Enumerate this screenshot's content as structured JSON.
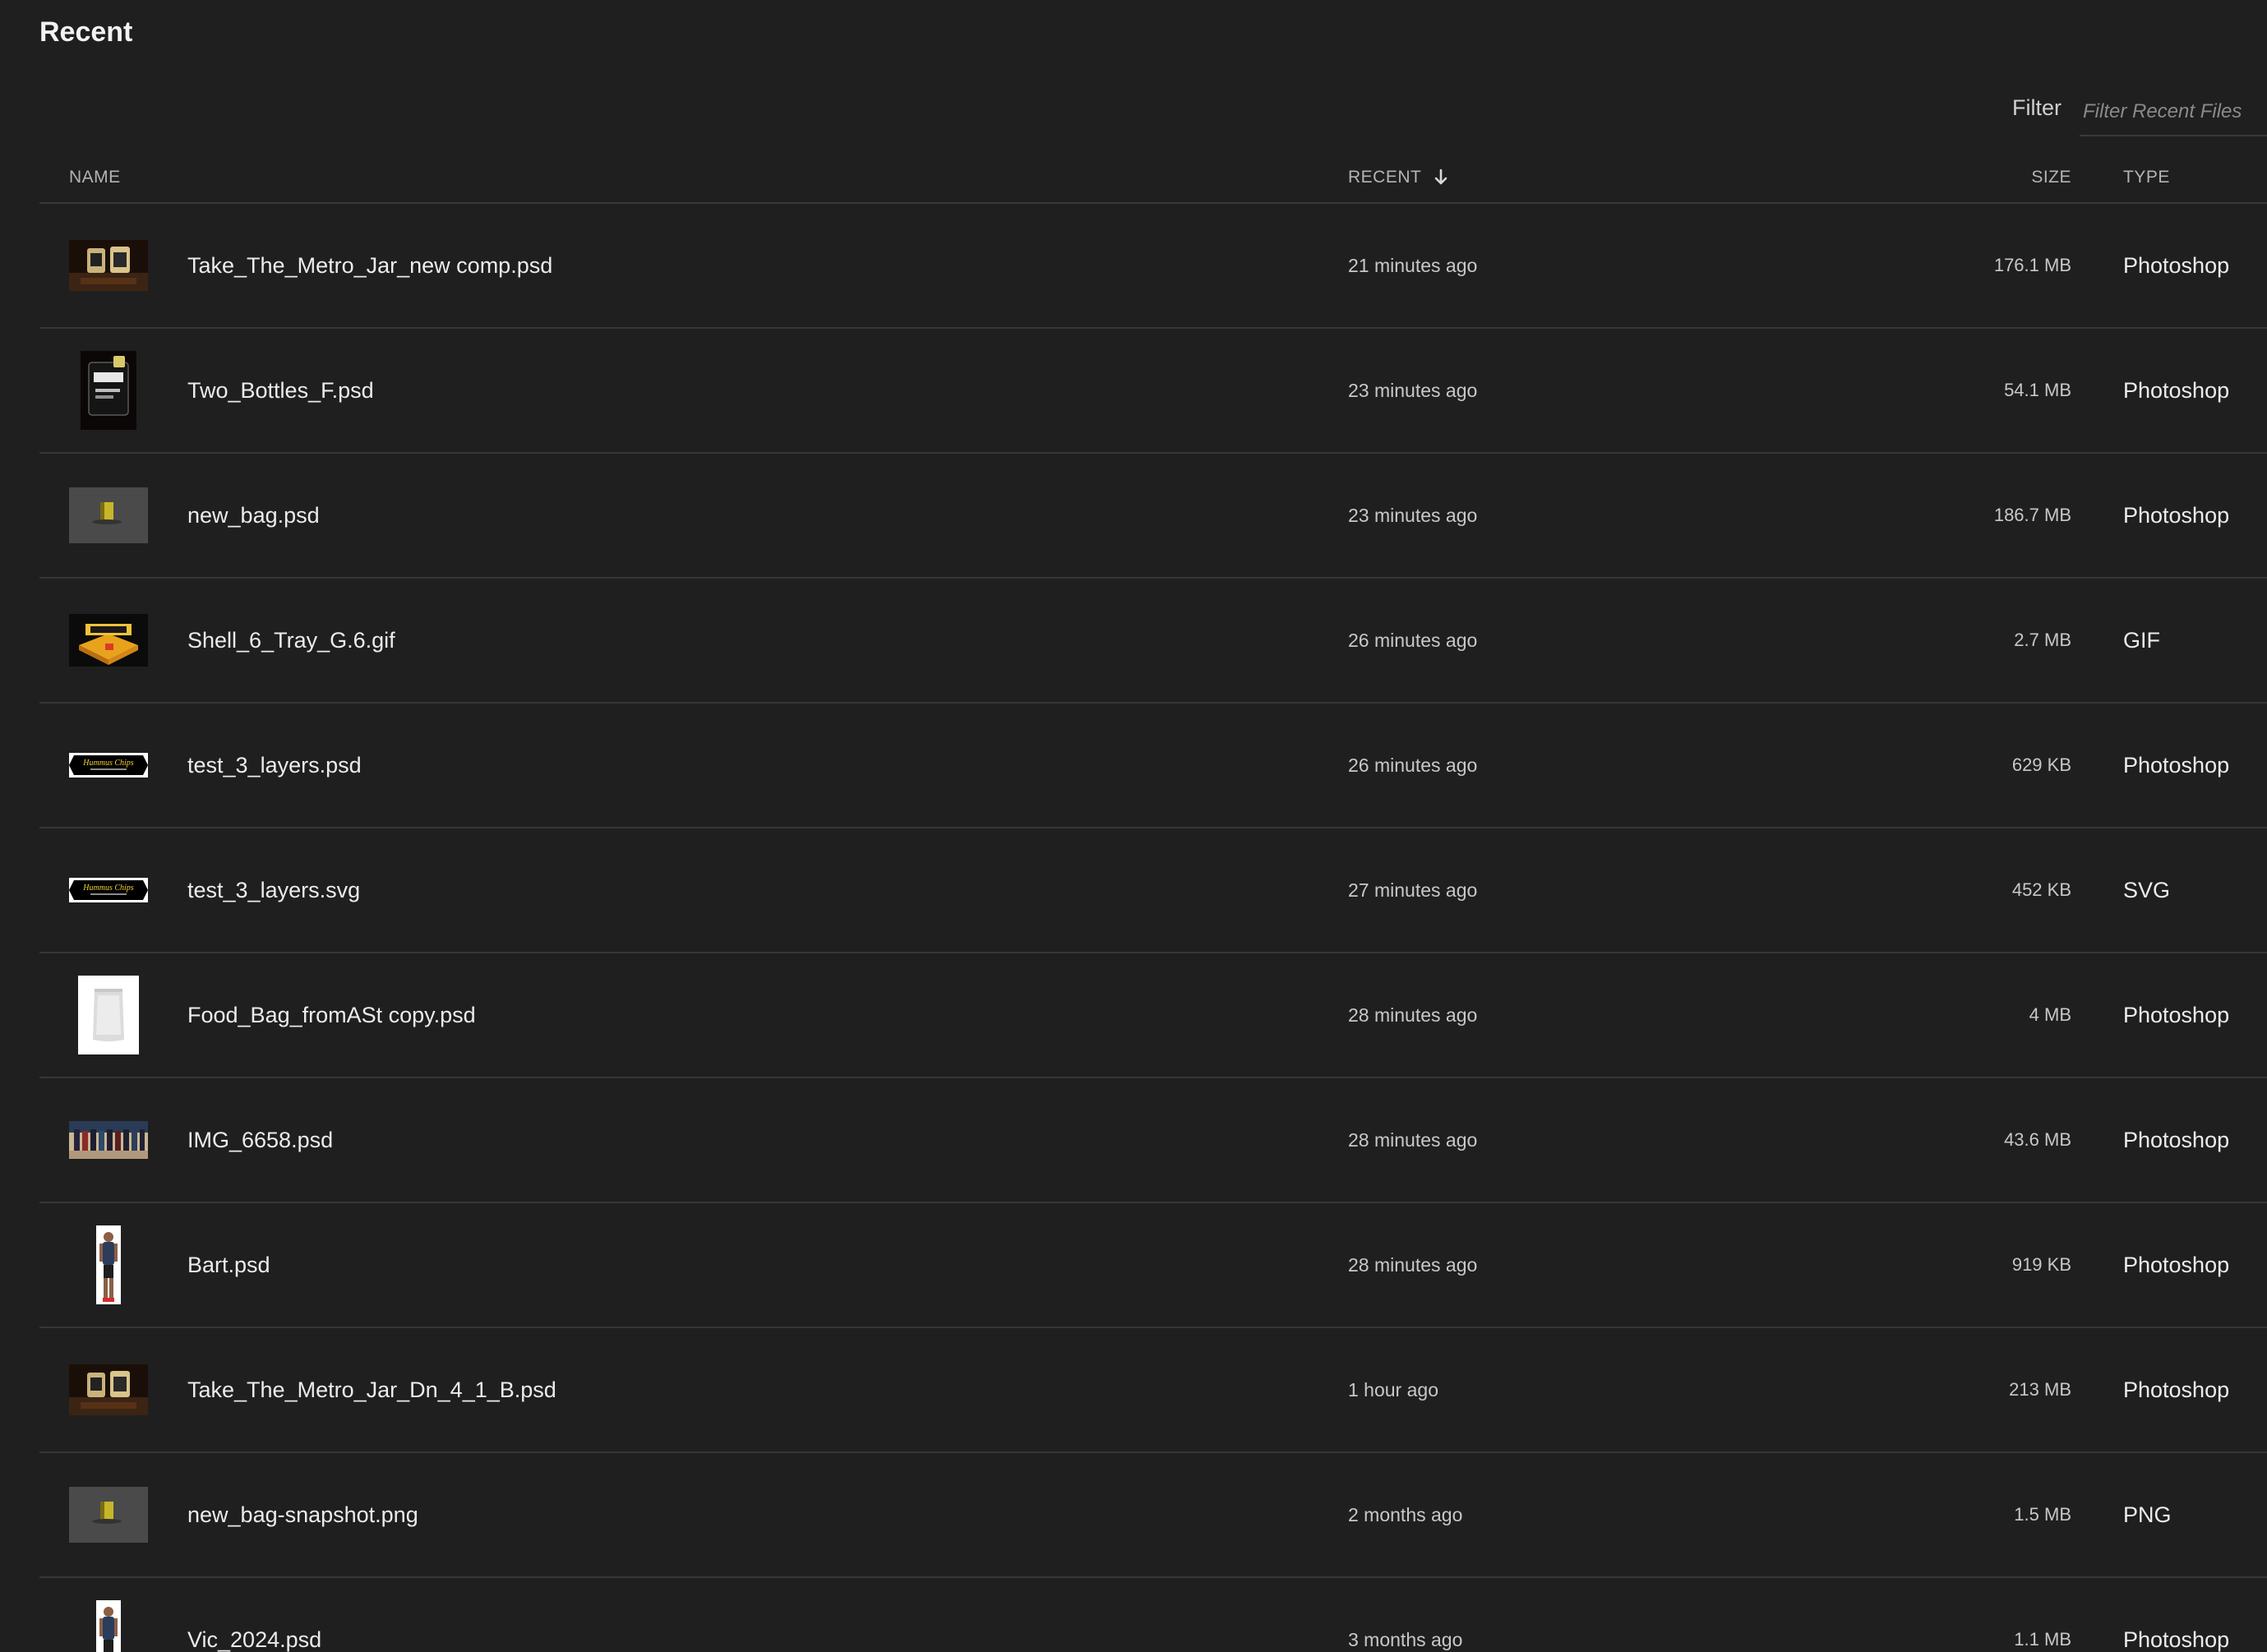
{
  "page": {
    "title": "Recent"
  },
  "filter": {
    "label": "Filter",
    "placeholder": "Filter Recent Files"
  },
  "columns": {
    "name": "NAME",
    "recent": "RECENT",
    "size": "SIZE",
    "type": "TYPE"
  },
  "sort": {
    "column": "recent",
    "direction": "descending",
    "icon": "arrow-down-icon"
  },
  "files": [
    {
      "name": "Take_The_Metro_Jar_new comp.psd",
      "recent": "21 minutes ago",
      "size": "176.1 MB",
      "type": "Photoshop",
      "thumbnail": "metro-jar-thumbnail"
    },
    {
      "name": "Two_Bottles_F.psd",
      "recent": "23 minutes ago",
      "size": "54.1 MB",
      "type": "Photoshop",
      "thumbnail": "two-bottles-thumbnail"
    },
    {
      "name": "new_bag.psd",
      "recent": "23 minutes ago",
      "size": "186.7 MB",
      "type": "Photoshop",
      "thumbnail": "bag-thumbnail"
    },
    {
      "name": "Shell_6_Tray_G.6.gif",
      "recent": "26 minutes ago",
      "size": "2.7 MB",
      "type": "GIF",
      "thumbnail": "tray-thumbnail"
    },
    {
      "name": "test_3_layers.psd",
      "recent": "26 minutes ago",
      "size": "629 KB",
      "type": "Photoshop",
      "thumbnail": "hummus-chips-label-thumbnail",
      "thumbnail_text": "Hummus Chips"
    },
    {
      "name": "test_3_layers.svg",
      "recent": "27 minutes ago",
      "size": "452 KB",
      "type": "SVG",
      "thumbnail": "hummus-chips-label-thumbnail",
      "thumbnail_text": "Hummus Chips"
    },
    {
      "name": "Food_Bag_fromASt copy.psd",
      "recent": "28 minutes ago",
      "size": "4 MB",
      "type": "Photoshop",
      "thumbnail": "food-bag-thumbnail"
    },
    {
      "name": "IMG_6658.psd",
      "recent": "28 minutes ago",
      "size": "43.6 MB",
      "type": "Photoshop",
      "thumbnail": "group-photo-thumbnail"
    },
    {
      "name": "Bart.psd",
      "recent": "28 minutes ago",
      "size": "919 KB",
      "type": "Photoshop",
      "thumbnail": "person-thumbnail"
    },
    {
      "name": "Take_The_Metro_Jar_Dn_4_1_B.psd",
      "recent": "1 hour ago",
      "size": "213 MB",
      "type": "Photoshop",
      "thumbnail": "metro-jar-thumbnail"
    },
    {
      "name": "new_bag-snapshot.png",
      "recent": "2 months ago",
      "size": "1.5 MB",
      "type": "PNG",
      "thumbnail": "bag-thumbnail"
    },
    {
      "name": "Vic_2024.psd",
      "recent": "3 months ago",
      "size": "1.1 MB",
      "type": "Photoshop",
      "thumbnail": "person-thumbnail"
    }
  ]
}
